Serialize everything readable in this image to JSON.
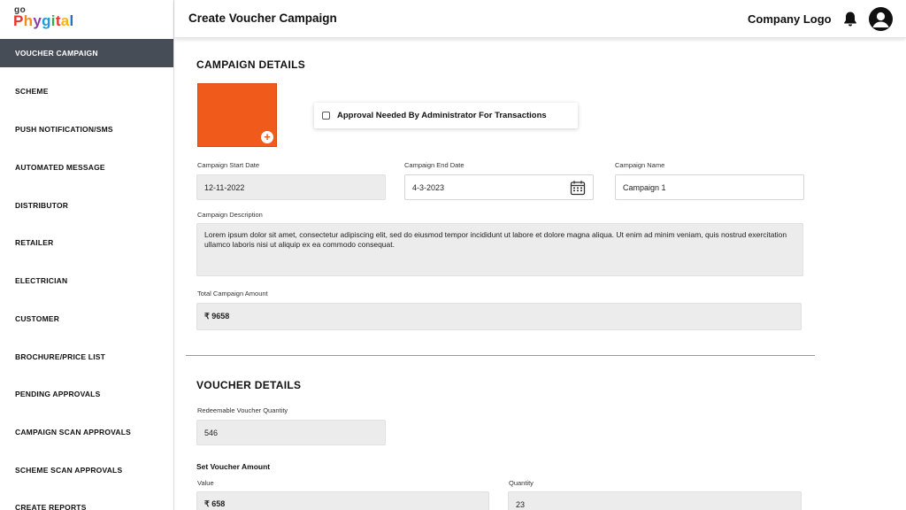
{
  "brand": {
    "prefix": "go",
    "letters": [
      "P",
      "h",
      "y",
      "g",
      "i",
      "t",
      "a",
      "l"
    ],
    "letter_colors": [
      "#e8342a",
      "#f08a1d",
      "#8a3fa0",
      "#1e9ad6",
      "#3aa84a",
      "#e8342a",
      "#f5b31a",
      "#2a6fc0"
    ]
  },
  "sidebar": {
    "items": [
      {
        "label": "VOUCHER CAMPAIGN",
        "active": true
      },
      {
        "label": "SCHEME"
      },
      {
        "label": "PUSH NOTIFICATION/SMS"
      },
      {
        "label": "AUTOMATED MESSAGE"
      },
      {
        "label": "DISTRIBUTOR"
      },
      {
        "label": "RETAILER"
      },
      {
        "label": "ELECTRICIAN"
      },
      {
        "label": "CUSTOMER"
      },
      {
        "label": "BROCHURE/PRICE LIST"
      },
      {
        "label": "PENDING APPROVALS"
      },
      {
        "label": "CAMPAIGN SCAN APPROVALS"
      },
      {
        "label": "SCHEME SCAN APPROVALS"
      },
      {
        "label": "CREATE REPORTS"
      }
    ]
  },
  "header": {
    "title": "Create Voucher Campaign",
    "company_logo": "Company Logo",
    "bell_icon": "bell-icon",
    "avatar_icon": "user-avatar-icon"
  },
  "campaign": {
    "title": "CAMPAIGN DETAILS",
    "upload_color": "#f05a1a",
    "approval_label": "Approval Needed By Administrator For Transactions",
    "approval_checked": false,
    "start_date_label": "Campaign Start Date",
    "start_date": "12-11-2022",
    "end_date_label": "Campaign End Date",
    "end_date": "4-3-2023",
    "name_label": "Campaign Name",
    "name": "Campaign 1",
    "description_label": "Campaign Description",
    "description": "Lorem ipsum dolor sit amet, consectetur adipiscing elit, sed do eiusmod tempor incididunt ut labore et dolore magna aliqua. Ut enim ad minim veniam, quis nostrud exercitation ullamco laboris nisi ut aliquip ex ea commodo consequat.",
    "total_label": "Total Campaign Amount",
    "total": "₹ 9658"
  },
  "voucher": {
    "title": "VOUCHER DETAILS",
    "qty_label": "Redeemable Voucher Quantity",
    "qty": "546",
    "set_amount_label": "Set Voucher Amount",
    "value_label": "Value",
    "value": "₹ 658",
    "quantity_label": "Quantity",
    "quantity": "23"
  }
}
